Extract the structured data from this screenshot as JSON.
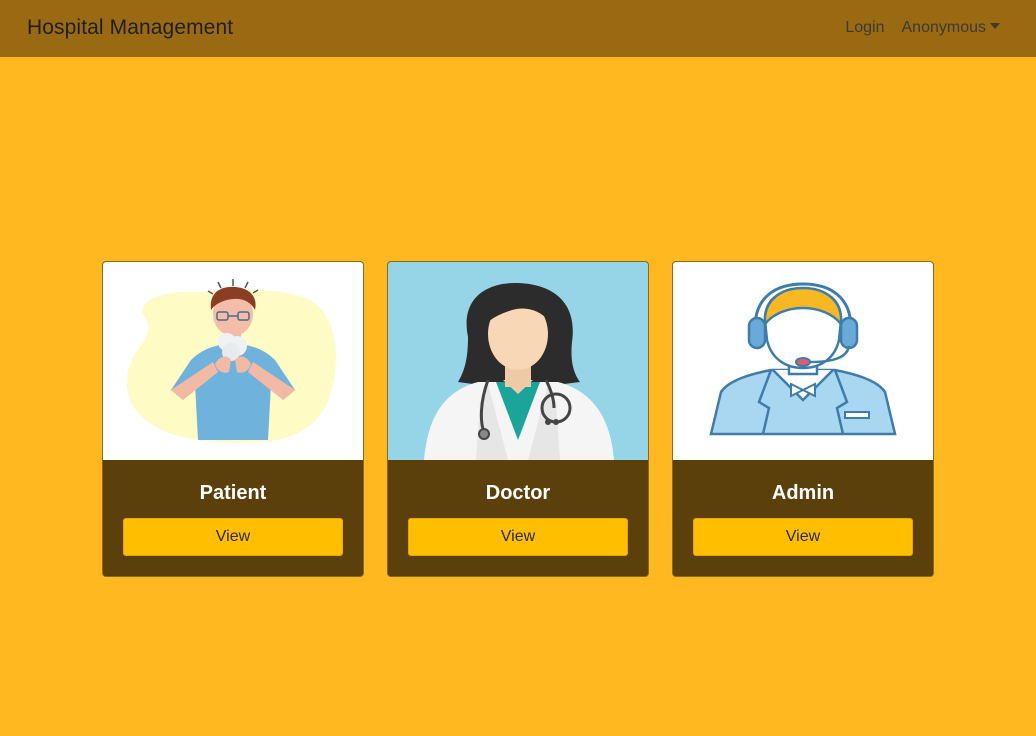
{
  "navbar": {
    "brand": "Hospital Management",
    "login_label": "Login",
    "user_label": "Anonymous"
  },
  "cards": [
    {
      "title": "Patient",
      "button_label": "View",
      "illustration": "patient-coughing-illustration"
    },
    {
      "title": "Doctor",
      "button_label": "View",
      "illustration": "doctor-with-stethoscope-illustration"
    },
    {
      "title": "Admin",
      "button_label": "View",
      "illustration": "admin-headset-illustration"
    }
  ],
  "colors": {
    "page_background": "#ffb81f",
    "navbar_background": "#9a6a12",
    "card_body": "#5b400c",
    "button": "#ffbf00",
    "doctor_image_background": "#95d5e7"
  }
}
